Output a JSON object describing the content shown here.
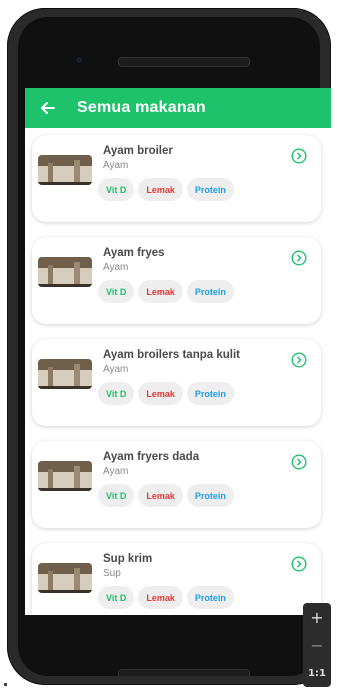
{
  "appbar": {
    "title": "Semua makanan",
    "back_icon": "arrow-left-icon",
    "color": "#1ec26b"
  },
  "items": [
    {
      "name": "Ayam broiler",
      "category": "Ayam",
      "tags": [
        "Vit D",
        "Lemak",
        "Protein"
      ]
    },
    {
      "name": "Ayam fryes",
      "category": "Ayam",
      "tags": [
        "Vit D",
        "Lemak",
        "Protein"
      ]
    },
    {
      "name": "Ayam broilers tanpa kulit",
      "category": "Ayam",
      "tags": [
        "Vit D",
        "Lemak",
        "Protein"
      ]
    },
    {
      "name": "Ayam fryers dada",
      "category": "Ayam",
      "tags": [
        "Vit D",
        "Lemak",
        "Protein"
      ]
    },
    {
      "name": "Sup krim",
      "category": "Sup",
      "tags": [
        "Vit D",
        "Lemak",
        "Protein"
      ]
    }
  ],
  "tag_colors": {
    "Vit D": "#1ec26b",
    "Lemak": "#e53935",
    "Protein": "#1e9fe6"
  },
  "item_action_icon": "chevron-right-circle-icon",
  "zoom": {
    "plus": "+",
    "minus": "−",
    "ratio": "1:1"
  }
}
